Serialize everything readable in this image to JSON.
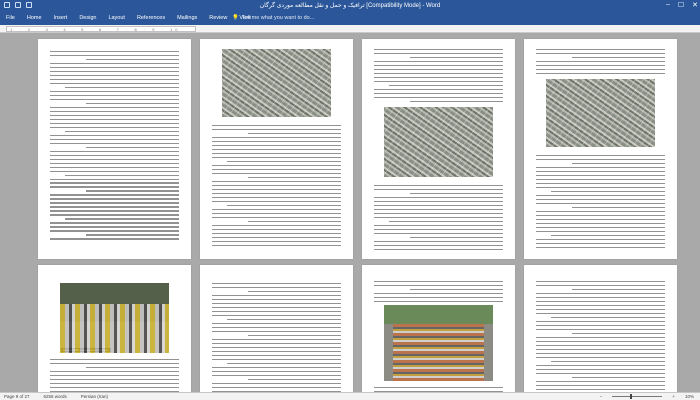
{
  "window": {
    "title": "ترافیک و حمل و نقل مطالعه موردی گرگان [Compatibility Mode] - Word",
    "minimize_glyph": "–",
    "maximize_glyph": "☐",
    "close_glyph": "✕"
  },
  "ribbon": {
    "tabs": [
      "File",
      "Home",
      "Insert",
      "Design",
      "Layout",
      "References",
      "Mailings",
      "Review",
      "View"
    ],
    "tell_me": "Tell me what you want to do...",
    "tell_me_icon": "lightbulb-icon"
  },
  "ruler": {
    "labels": "1 · 2 · 3 · 4 · 5 · 6 · 7 · 8 · 9 · 10"
  },
  "pages": {
    "top": [
      {
        "type": "text"
      },
      {
        "type": "aerial-top"
      },
      {
        "type": "aerial-middle"
      },
      {
        "type": "aerial-top-right"
      }
    ],
    "bottom": [
      {
        "type": "traffic-photo",
        "caption": "Grand traffic congestion in Gorgan"
      },
      {
        "type": "text"
      },
      {
        "type": "street-photo"
      },
      {
        "type": "text"
      }
    ]
  },
  "statusbar": {
    "page": "Page 9 of 27",
    "words": "6255 words",
    "language": "Persian (Iran)",
    "zoom_minus": "−",
    "zoom_plus": "+",
    "zoom": "10%"
  }
}
